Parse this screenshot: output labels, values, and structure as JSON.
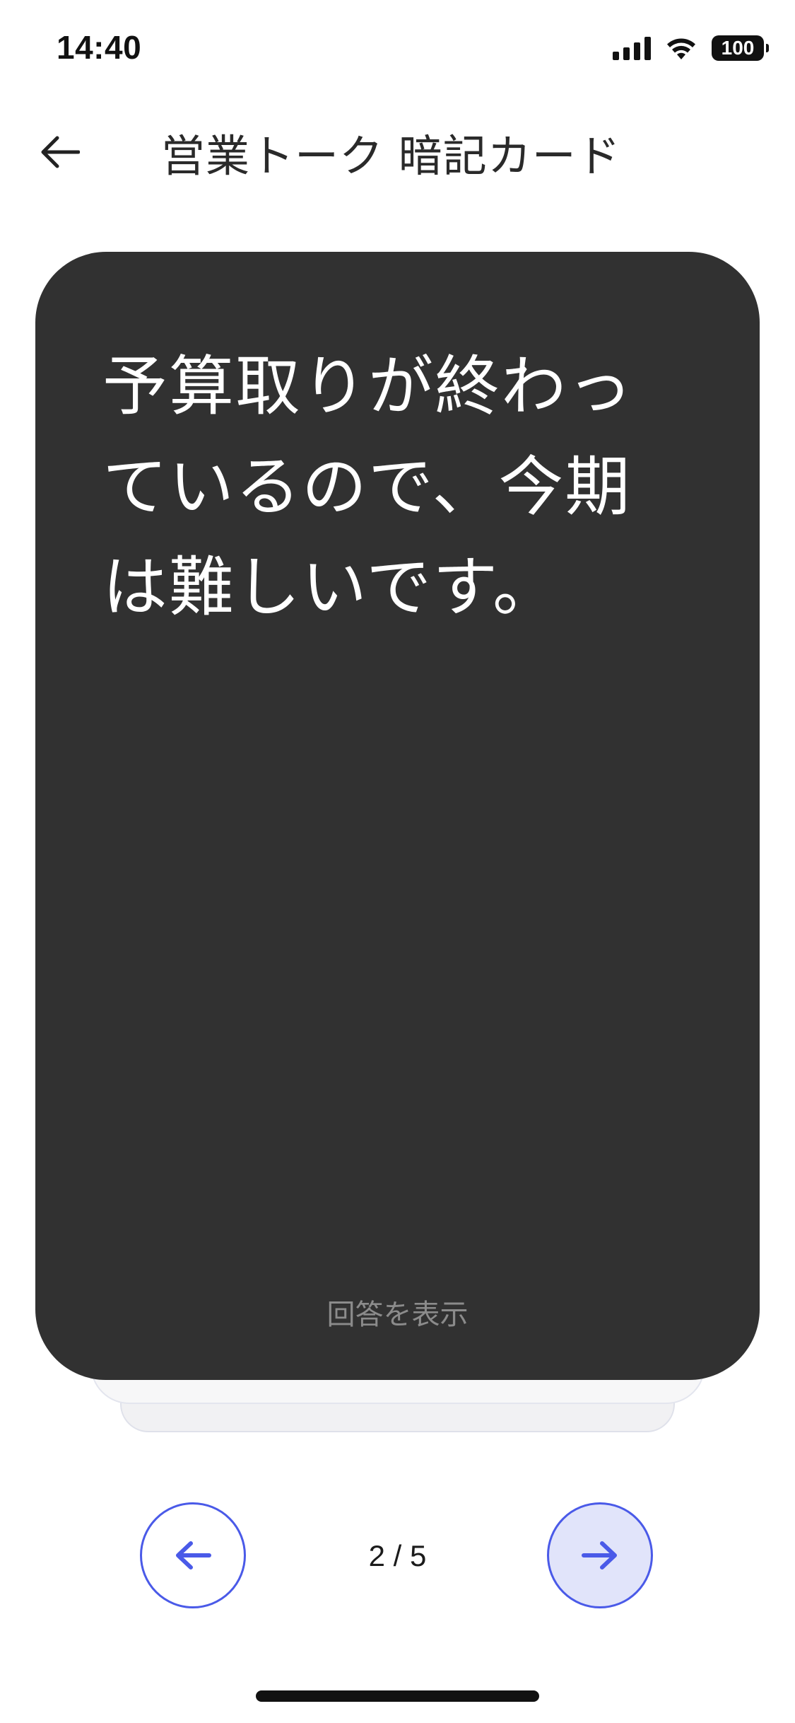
{
  "status_bar": {
    "time": "14:40",
    "battery": "100",
    "icons": [
      "signal-icon",
      "wifi-icon",
      "battery-icon"
    ]
  },
  "header": {
    "back_icon": "arrow-left-icon",
    "title": "営業トーク 暗記カード"
  },
  "card": {
    "question": "予算取りが終わっているので、今期は難しいです。",
    "show_answer_label": "回答を表示"
  },
  "navigation": {
    "prev_icon": "arrow-left-icon",
    "next_icon": "arrow-right-icon",
    "counter": "2 / 5"
  },
  "colors": {
    "card_background": "#313131",
    "accent": "#4a5ae8",
    "next_button_fill": "#e1e4fa"
  }
}
